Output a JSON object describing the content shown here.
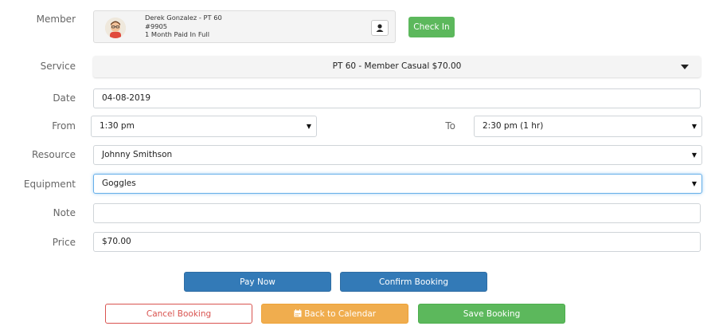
{
  "labels": {
    "member": "Member",
    "service": "Service",
    "date": "Date",
    "from": "From",
    "to": "To",
    "resource": "Resource",
    "equipment": "Equipment",
    "note": "Note",
    "price": "Price"
  },
  "member": {
    "name_line": "Derek Gonzalez - PT 60",
    "id": "#9905",
    "plan": "1 Month Paid In Full",
    "check_in_label": "Check In"
  },
  "service": {
    "value": "PT 60 - Member Casual $70.00"
  },
  "date": {
    "value": "04-08-2019"
  },
  "from": {
    "value": "1:30 pm"
  },
  "to": {
    "value": "2:30 pm (1 hr)"
  },
  "resource": {
    "value": "Johnny Smithson"
  },
  "equipment": {
    "value": "Goggles"
  },
  "note": {
    "value": ""
  },
  "price": {
    "value": "$70.00"
  },
  "buttons": {
    "pay_now": "Pay Now",
    "confirm_booking": "Confirm Booking",
    "cancel_booking": "Cancel Booking",
    "back_to_calendar": "Back to Calendar",
    "save_booking": "Save Booking"
  },
  "colors": {
    "green": "#5cb85c",
    "blue": "#337ab7",
    "orange": "#f0ad4e",
    "red": "#d9534f",
    "focus": "#66afe9"
  },
  "icons": {
    "user": "user-icon",
    "dropdown": "caret-down-icon",
    "calendar": "calendar-icon"
  }
}
